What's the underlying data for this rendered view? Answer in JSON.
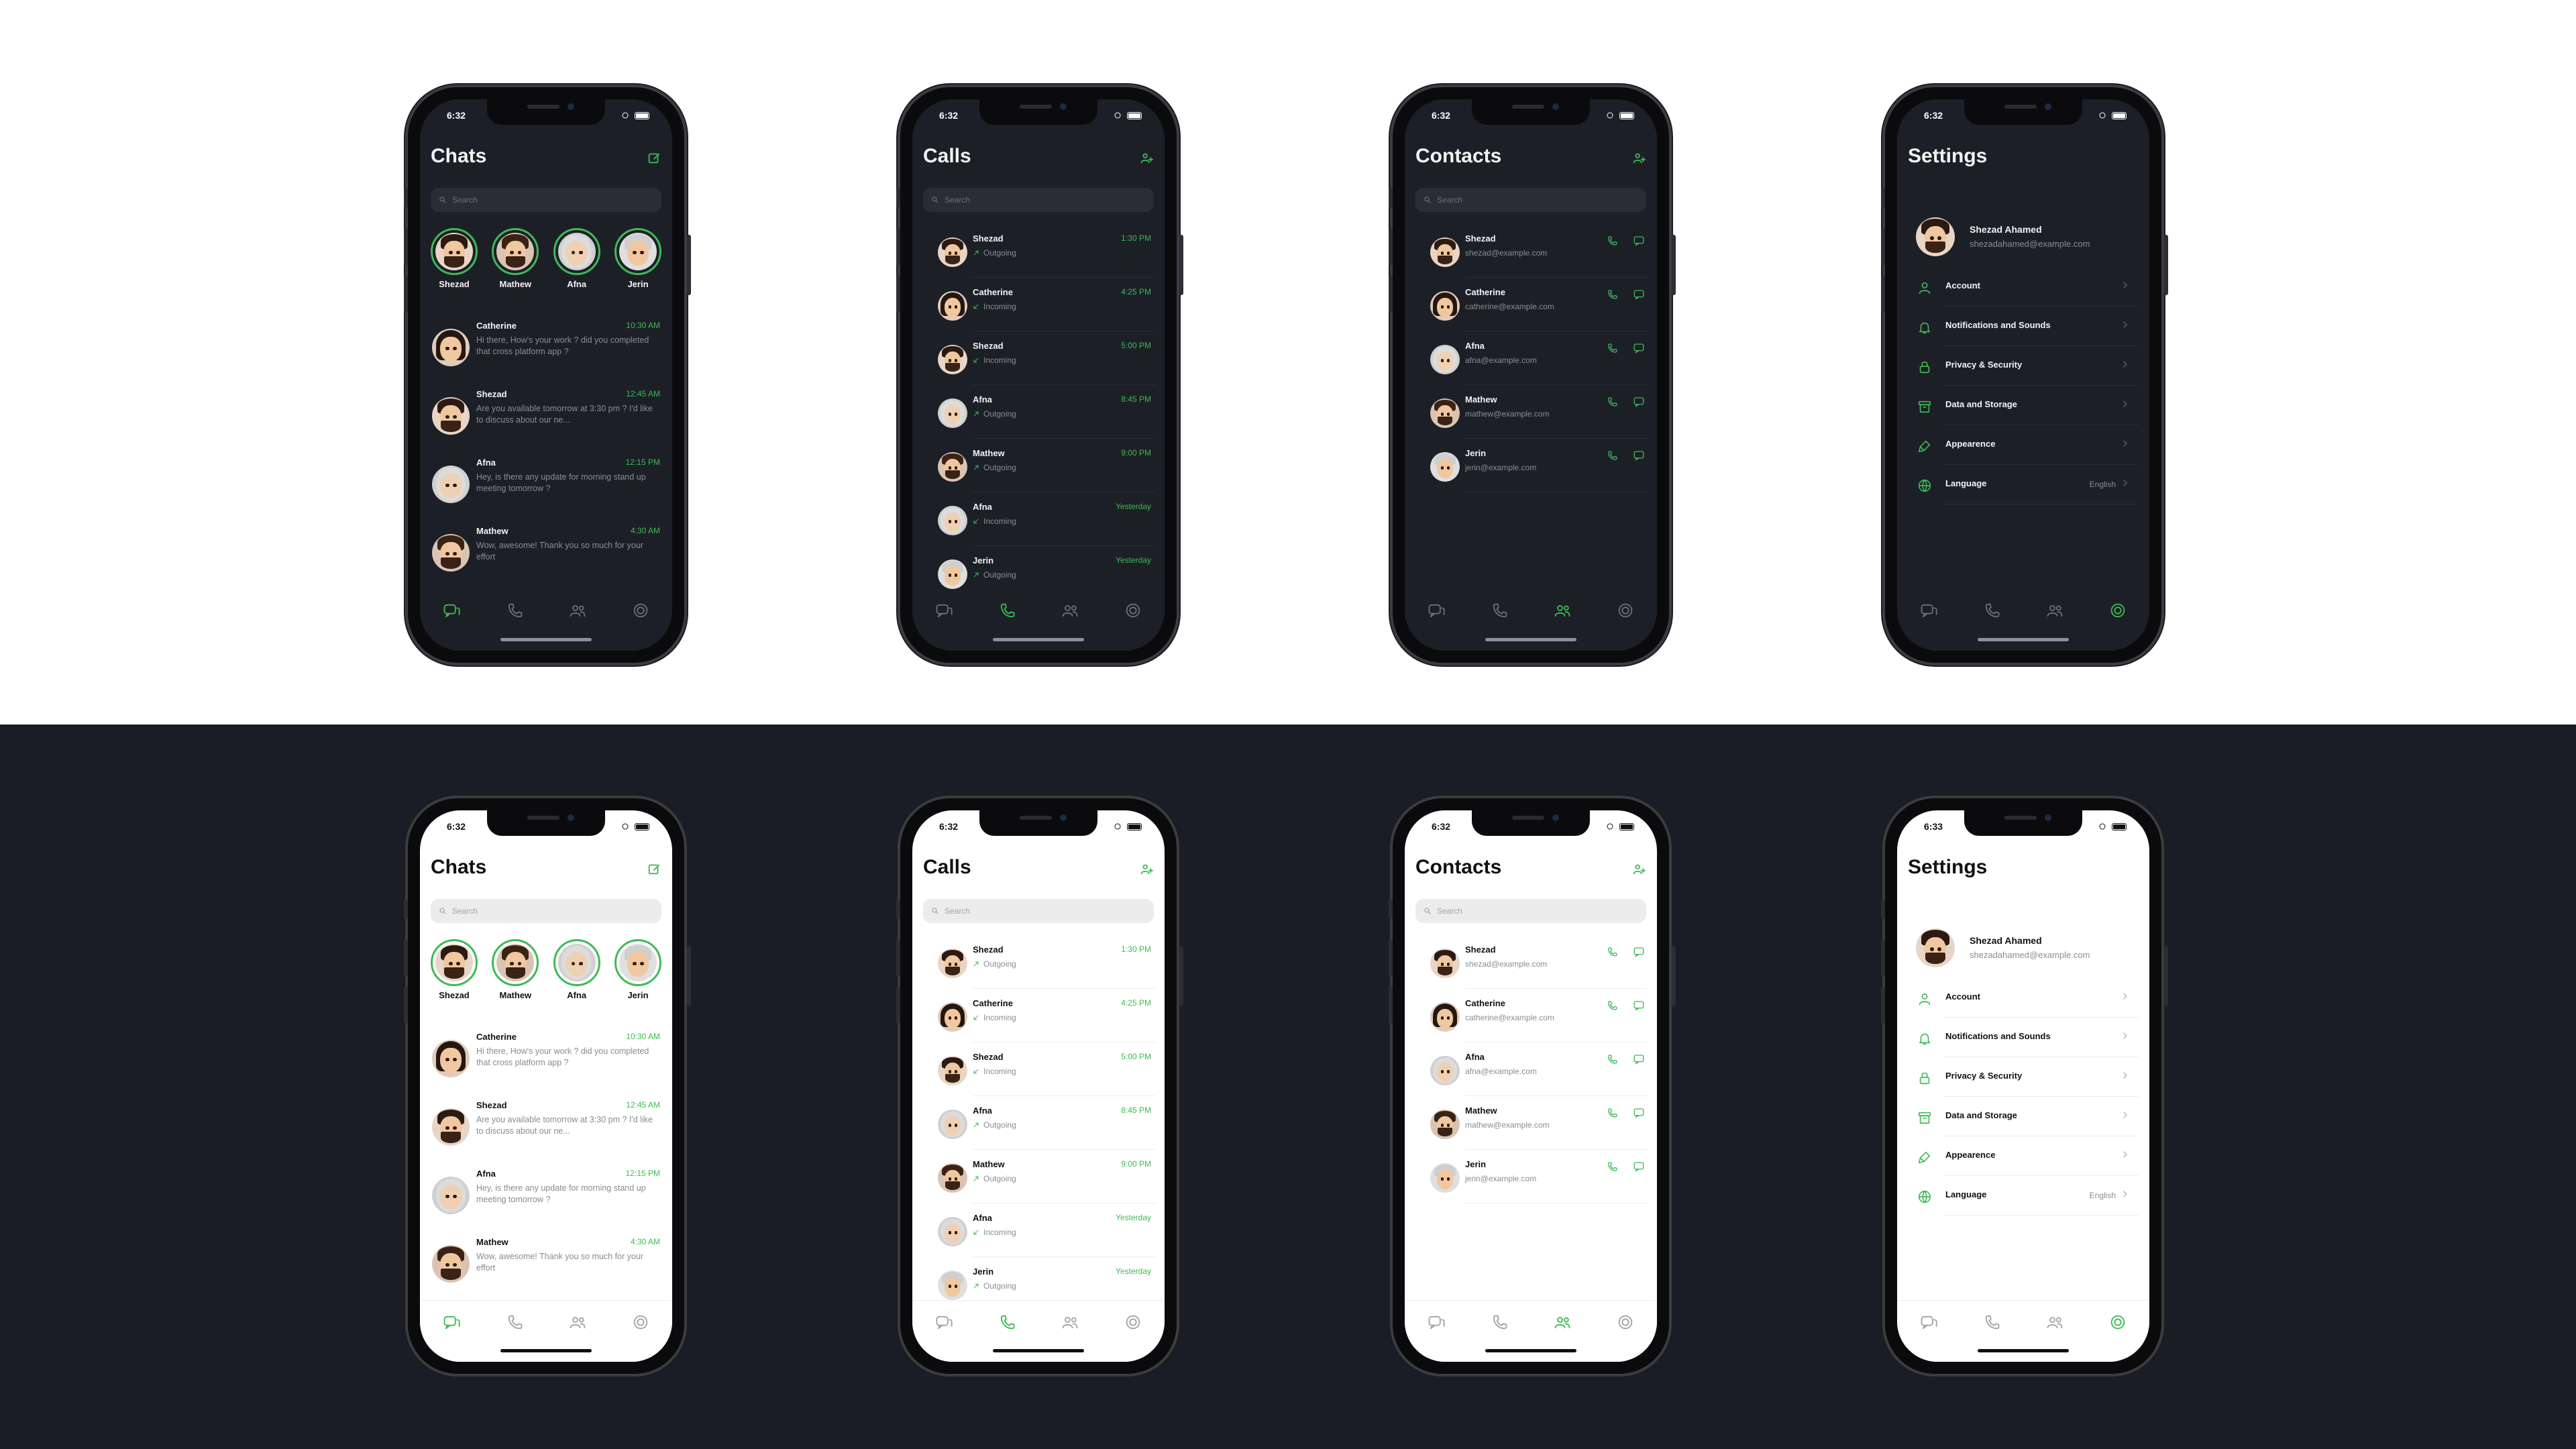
{
  "status_time": "6:32",
  "status_time_alt": "6:33",
  "colors": {
    "accent": "#3dbb54",
    "dark_bg": "#1d1f27",
    "light_bg": "#ffffff",
    "canvas_dark": "#1a1c26"
  },
  "search_placeholder": "Search",
  "chats": {
    "title": "Chats",
    "compose_icon": "compose-icon",
    "stories": [
      {
        "name": "Shezad"
      },
      {
        "name": "Mathew"
      },
      {
        "name": "Afna"
      },
      {
        "name": "Jerin"
      }
    ],
    "items": [
      {
        "name": "Catherine",
        "time": "10:30 AM",
        "message": "Hi there, How's your work ? did you completed that cross platform app ?"
      },
      {
        "name": "Shezad",
        "time": "12:45 AM",
        "message": "Are you available tomorrow at 3:30 pm ? I'd like to discuss about our ne..."
      },
      {
        "name": "Afna",
        "time": "12:15 PM",
        "message": "Hey, is there any update for morning stand up meeting tomorrow ?"
      },
      {
        "name": "Mathew",
        "time": "4:30 AM",
        "message": "Wow, awesome! Thank you so much for your effort"
      }
    ]
  },
  "calls": {
    "title": "Calls",
    "add_icon": "add-contact-icon",
    "items": [
      {
        "name": "Shezad",
        "direction": "Outgoing",
        "time": "1:30 PM"
      },
      {
        "name": "Catherine",
        "direction": "Incoming",
        "time": "4:25 PM"
      },
      {
        "name": "Shezad",
        "direction": "Incoming",
        "time": "5:00 PM"
      },
      {
        "name": "Afna",
        "direction": "Outgoing",
        "time": "8:45 PM"
      },
      {
        "name": "Mathew",
        "direction": "Outgoing",
        "time": "9:00 PM"
      },
      {
        "name": "Afna",
        "direction": "Incoming",
        "time": "Yesterday"
      },
      {
        "name": "Jerin",
        "direction": "Outgoing",
        "time": "Yesterday"
      }
    ]
  },
  "contacts": {
    "title": "Contacts",
    "add_icon": "add-contact-icon",
    "items": [
      {
        "name": "Shezad",
        "email": "shezad@example.com"
      },
      {
        "name": "Catherine",
        "email": "catherine@example.com"
      },
      {
        "name": "Afna",
        "email": "afna@example.com"
      },
      {
        "name": "Mathew",
        "email": "mathew@example.com"
      },
      {
        "name": "Jerin",
        "email": "jerin@example.com"
      }
    ]
  },
  "settings": {
    "title": "Settings",
    "profile": {
      "name": "Shezad Ahamed",
      "email": "shezadahamed@example.com"
    },
    "items": [
      {
        "label": "Account",
        "icon": "person-icon"
      },
      {
        "label": "Notifications and Sounds",
        "icon": "bell-icon"
      },
      {
        "label": "Privacy & Security",
        "icon": "lock-icon"
      },
      {
        "label": "Data and Storage",
        "icon": "archive-icon"
      },
      {
        "label": "Appearence",
        "icon": "brush-icon"
      },
      {
        "label": "Language",
        "icon": "globe-icon",
        "value": "English"
      }
    ]
  },
  "tabs": [
    "chats-tab",
    "calls-tab",
    "contacts-tab",
    "settings-tab"
  ]
}
